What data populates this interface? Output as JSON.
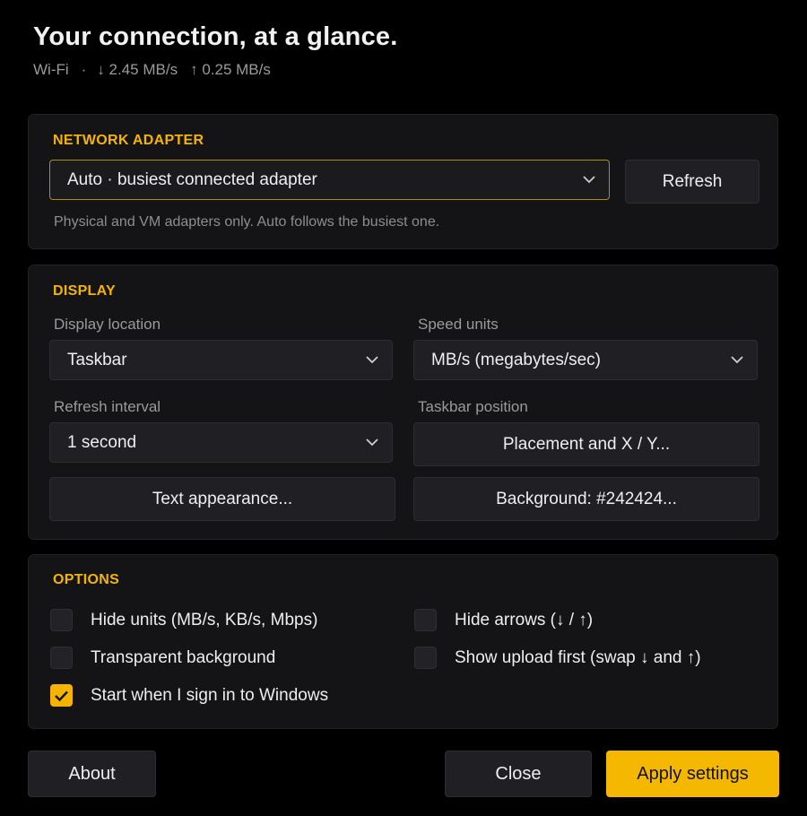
{
  "header": {
    "title": "Your connection, at a glance.",
    "connection_type": "Wi-Fi",
    "separator": "·",
    "download_speed": "↓ 2.45 MB/s",
    "upload_speed": "↑ 0.25 MB/s"
  },
  "adapter": {
    "section_label": "NETWORK ADAPTER",
    "selected": "Auto · busiest connected adapter",
    "refresh_label": "Refresh",
    "hint": "Physical and VM adapters only. Auto follows the busiest one."
  },
  "display": {
    "section_label": "DISPLAY",
    "location_label": "Display location",
    "location_value": "Taskbar",
    "units_label": "Speed units",
    "units_value": "MB/s (megabytes/sec)",
    "interval_label": "Refresh interval",
    "interval_value": "1 second",
    "taskbar_position_label": "Taskbar position",
    "placement_button": "Placement and X / Y...",
    "text_appearance_button": "Text appearance...",
    "background_button": "Background: #242424..."
  },
  "options": {
    "section_label": "OPTIONS",
    "hide_units": {
      "label": "Hide units (MB/s, KB/s, Mbps)",
      "checked": false
    },
    "hide_arrows": {
      "label": "Hide arrows (↓ / ↑)",
      "checked": false
    },
    "transparent_bg": {
      "label": "Transparent background",
      "checked": false
    },
    "upload_first": {
      "label": "Show upload first (swap ↓ and ↑)",
      "checked": false
    },
    "start_on_signin": {
      "label": "Start when I sign in to Windows",
      "checked": true
    }
  },
  "footer": {
    "about_label": "About",
    "close_label": "Close",
    "apply_label": "Apply settings"
  },
  "colors": {
    "accent": "#f5b400",
    "background": "#000000",
    "card": "#141417",
    "control": "#202024"
  }
}
